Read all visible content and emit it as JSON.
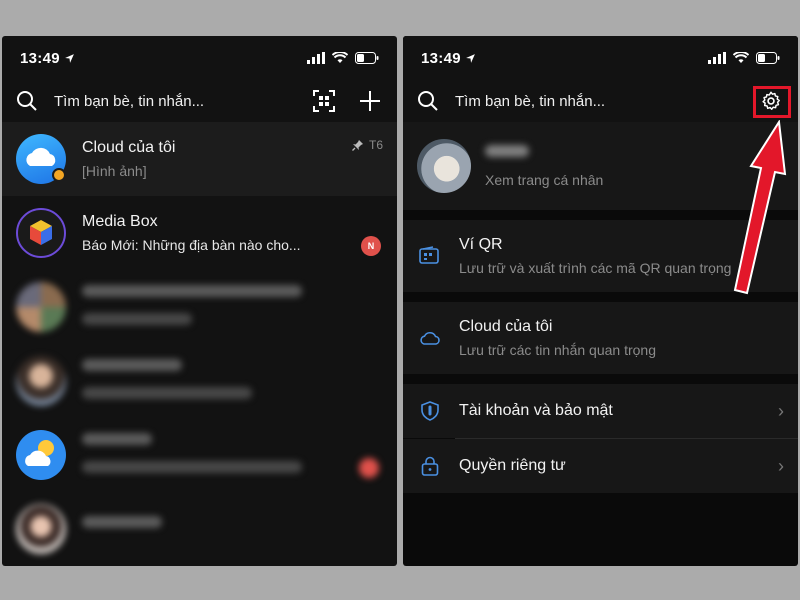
{
  "left": {
    "status": {
      "time": "13:49"
    },
    "search_placeholder": "Tìm bạn bè, tin nhắn...",
    "chats": [
      {
        "name": "Cloud của tôi",
        "preview": "[Hình ảnh]",
        "meta": "T6",
        "pinned": true
      },
      {
        "name": "Media Box",
        "preview": "Báo Mới: Những địa bàn nào cho...",
        "badge": "N"
      }
    ]
  },
  "right": {
    "status": {
      "time": "13:49"
    },
    "search_placeholder": "Tìm bạn bè, tin nhắn...",
    "profile": {
      "subtitle": "Xem trang cá nhân"
    },
    "menu": [
      {
        "title": "Ví QR",
        "subtitle": "Lưu trữ và xuất trình các mã QR quan trọng"
      },
      {
        "title": "Cloud của tôi",
        "subtitle": "Lưu trữ các tin nhắn quan trọng"
      },
      {
        "title": "Tài khoản và bảo mật"
      },
      {
        "title": "Quyền riêng tư"
      }
    ]
  },
  "colors": {
    "accent": "#4a90e2",
    "highlight": "#e3172a",
    "badge": "#e0514b"
  }
}
